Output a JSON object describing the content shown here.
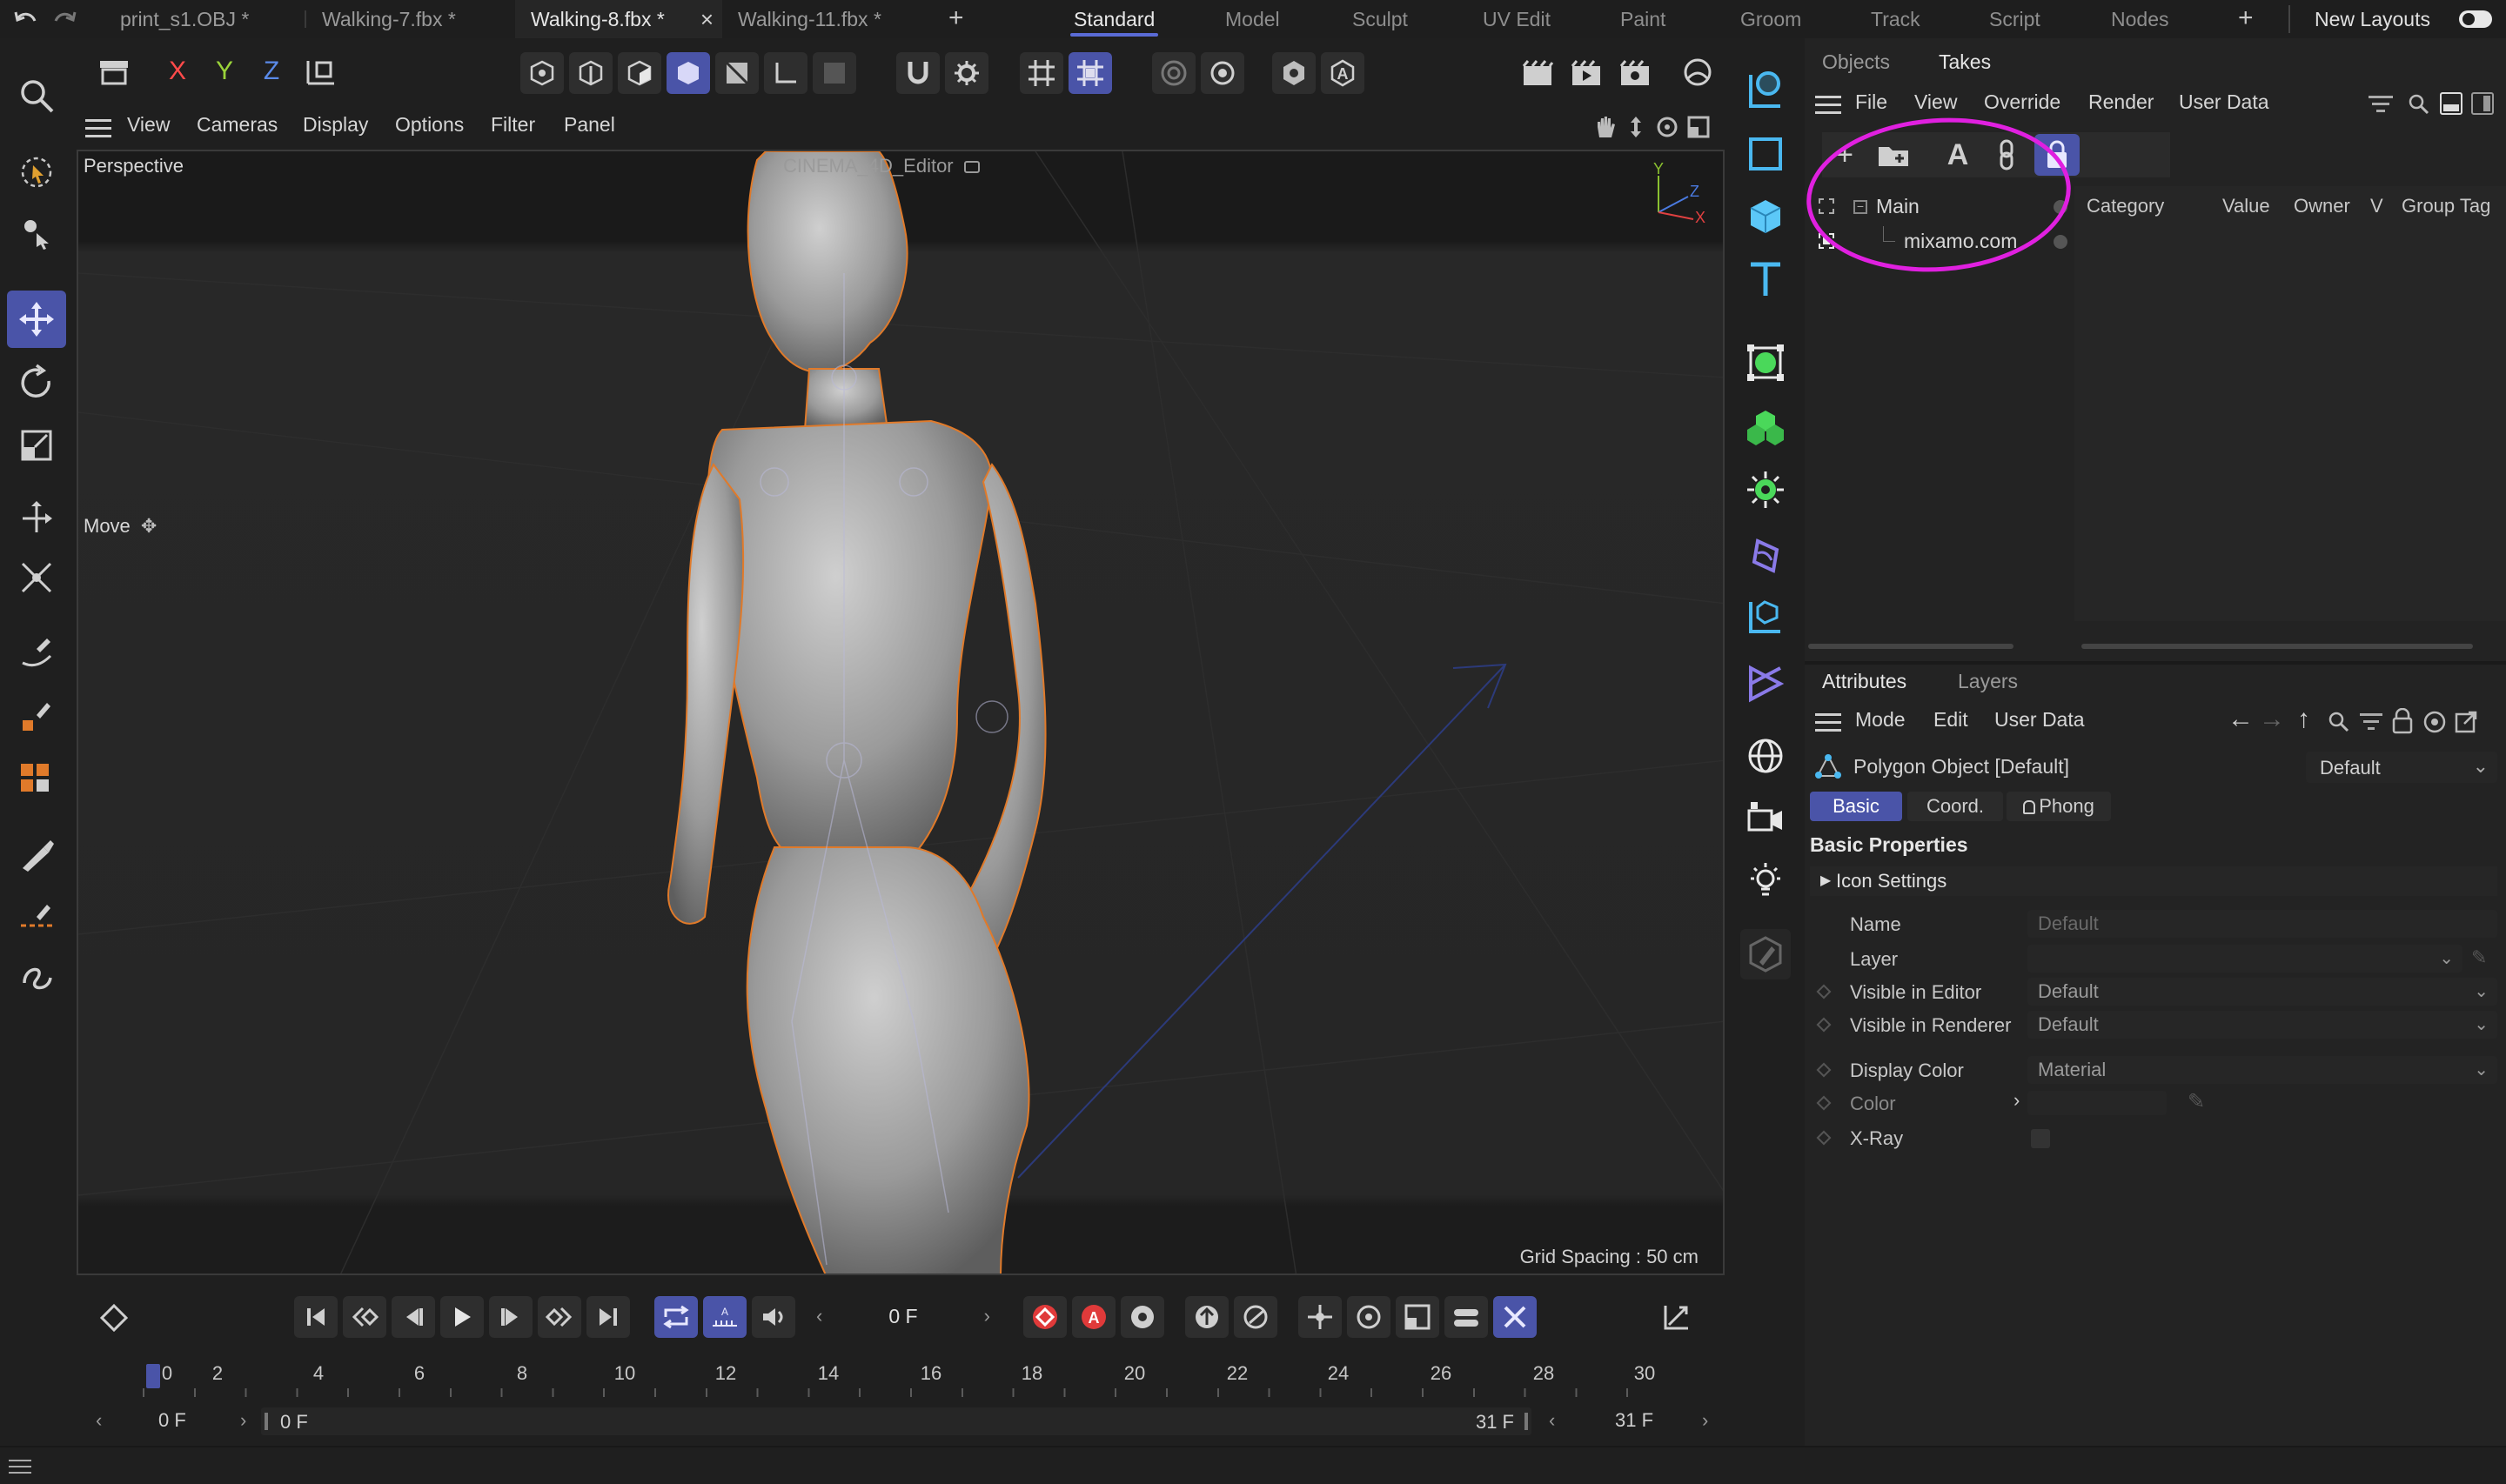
{
  "tabs": [
    {
      "label": "print_s1.OBJ *"
    },
    {
      "label": "Walking-7.fbx *"
    },
    {
      "label": "Walking-8.fbx *",
      "close": "×"
    },
    {
      "label": "Walking-11.fbx *"
    }
  ],
  "new_tab": "+",
  "layouts": [
    "Standard",
    "Model",
    "Sculpt",
    "UV Edit",
    "Paint",
    "Groom",
    "Track",
    "Script",
    "Nodes"
  ],
  "layout_add": "+",
  "new_layouts": "New Layouts",
  "axis": {
    "x": "X",
    "y": "Y",
    "z": "Z"
  },
  "viewport": {
    "menus": [
      "View",
      "Cameras",
      "Display",
      "Options",
      "Filter",
      "Panel"
    ],
    "camera": "Perspective",
    "renderer": "CINEMA_4D_Editor",
    "tool": "Move",
    "grid": "Grid Spacing : 50 cm",
    "gizmo": {
      "y": "Y",
      "z": "Z",
      "x": "X"
    }
  },
  "timeline": {
    "frame": "0 F",
    "ticks": [
      "0",
      "2",
      "4",
      "6",
      "8",
      "10",
      "12",
      "14",
      "16",
      "18",
      "20",
      "22",
      "24",
      "26",
      "28",
      "30"
    ],
    "start": "0 F",
    "range_start": "0 F",
    "range_end": "31 F",
    "end": "31 F"
  },
  "objects_panel": {
    "tabs": [
      "Objects",
      "Takes"
    ],
    "menus": [
      "File",
      "View",
      "Override",
      "Render",
      "User Data"
    ],
    "tree": [
      "Main",
      "mixamo.com"
    ],
    "columns": [
      "Category",
      "Value",
      "Owner",
      "V",
      "Group Tag"
    ]
  },
  "attributes_panel": {
    "tabs": [
      "Attributes",
      "Layers"
    ],
    "menus": [
      "Mode",
      "Edit",
      "User Data"
    ],
    "object": "Polygon Object [Default]",
    "preset": "Default",
    "subtabs": [
      "Basic",
      "Coord.",
      "Phong"
    ],
    "section": "Basic Properties",
    "subsection": "Icon Settings",
    "rows": [
      {
        "label": "Name",
        "value": "Default"
      },
      {
        "label": "Layer",
        "value": ""
      },
      {
        "label": "Visible in Editor",
        "value": "Default"
      },
      {
        "label": "Visible in Renderer",
        "value": "Default"
      },
      {
        "label": "Display Color",
        "value": "Material"
      },
      {
        "label": "Color",
        "value": ""
      },
      {
        "label": "X-Ray",
        "value": ""
      }
    ]
  },
  "colors": {
    "accent": "#4a54a8",
    "annotation": "#e020e0",
    "selection": "#e07a2a"
  }
}
